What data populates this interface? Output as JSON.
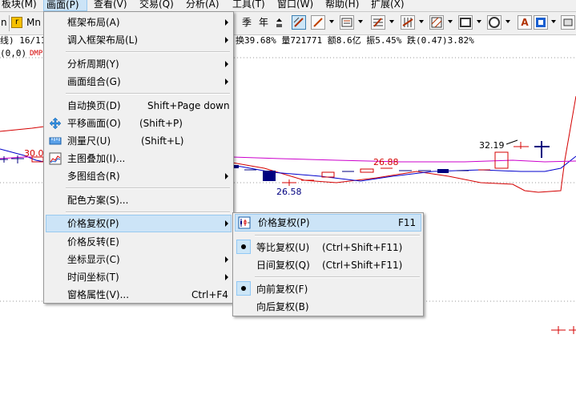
{
  "menubar": {
    "items": [
      "板块(M)",
      "画面(P)",
      "查看(V)",
      "交易(Q)",
      "分析(A)",
      "工具(T)",
      "窗口(W)",
      "帮助(H)",
      "扩展(X)"
    ],
    "active": "画面(P)"
  },
  "toolbar": {
    "left_text": "n",
    "r_badge": "r",
    "mn_label": "Mn",
    "season_label": "季",
    "year_label": "年"
  },
  "chart": {
    "info_left_line1": "线) 16/11",
    "info_left_line2_prefix": "(0,0)",
    "info_left_line2_suffix": "DMP",
    "info_right": "换39.68% 量721771 额8.6亿 振5.45% 跌(0.47)3.82%",
    "price_labels": [
      "30.0",
      "32.19",
      "26.88",
      "26.58"
    ],
    "colors": {
      "up": "#d40000",
      "down": "#000080",
      "ma1": "#cc00cc",
      "ma2": "#0000cc"
    }
  },
  "main_menu": {
    "items": [
      {
        "label": "框架布局(A)",
        "shortcut": "",
        "submenu": true
      },
      {
        "label": "调入框架布局(L)",
        "shortcut": "",
        "submenu": true
      },
      {
        "label": "分析周期(Y)",
        "shortcut": "",
        "submenu": true
      },
      {
        "label": "画面组合(G)",
        "shortcut": "",
        "submenu": true
      },
      {
        "label": "自动换页(D)",
        "shortcut": "Shift+Page down",
        "submenu": false
      },
      {
        "label": "平移画面(O)",
        "shortcut": "(Shift+P)",
        "submenu": false
      },
      {
        "label": "测量尺(U)",
        "shortcut": "(Shift+L)",
        "submenu": false
      },
      {
        "label": "主图叠加(I)...",
        "shortcut": "",
        "submenu": false
      },
      {
        "label": "多图组合(R)",
        "shortcut": "",
        "submenu": true
      },
      {
        "label": "配色方案(S)...",
        "shortcut": "",
        "submenu": false
      },
      {
        "label": "价格复权(P)",
        "shortcut": "",
        "submenu": true
      },
      {
        "label": "价格反转(E)",
        "shortcut": "",
        "submenu": false
      },
      {
        "label": "坐标显示(C)",
        "shortcut": "",
        "submenu": true
      },
      {
        "label": "时间坐标(T)",
        "shortcut": "",
        "submenu": true
      },
      {
        "label": "窗格属性(V)...",
        "shortcut": "Ctrl+F4",
        "submenu": false
      }
    ]
  },
  "sub_menu": {
    "items": [
      {
        "label": "价格复权(P)",
        "shortcut": "F11",
        "checked": false
      },
      {
        "label": "等比复权(U)",
        "shortcut": "(Ctrl+Shift+F11)",
        "checked": true
      },
      {
        "label": "日间复权(Q)",
        "shortcut": "(Ctrl+Shift+F11)",
        "checked": false
      },
      {
        "label": "向前复权(F)",
        "shortcut": "",
        "checked": true
      },
      {
        "label": "向后复权(B)",
        "shortcut": "",
        "checked": false
      }
    ]
  }
}
